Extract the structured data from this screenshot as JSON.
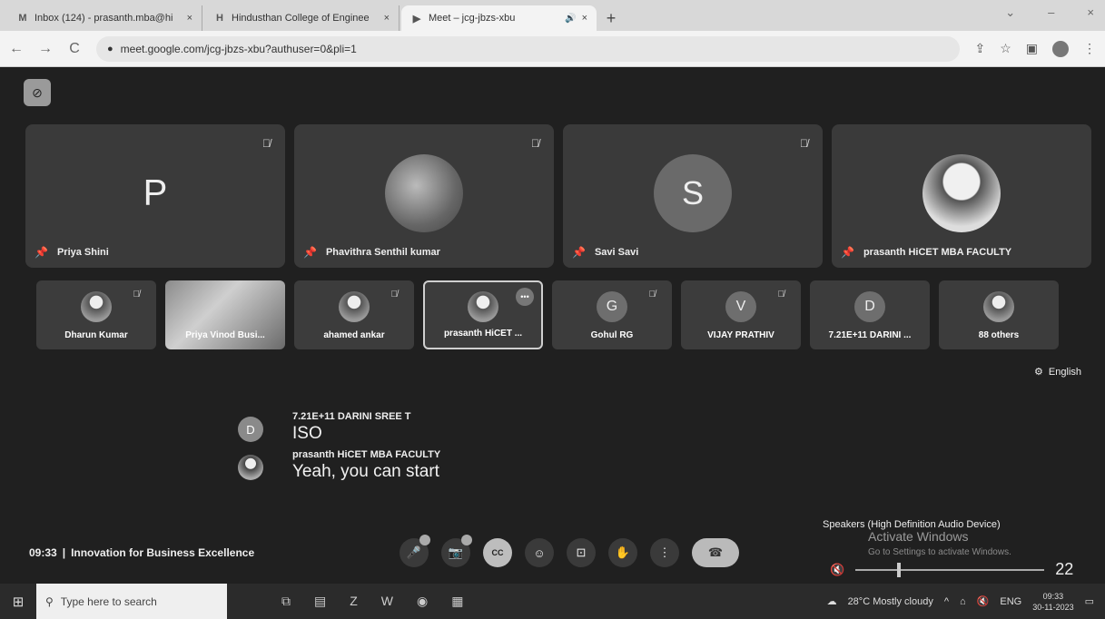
{
  "browser": {
    "tabs": [
      {
        "icon": "M",
        "title": "Inbox (124) - prasanth.mba@hi",
        "close": "×"
      },
      {
        "icon": "H",
        "title": "Hindusthan College of Enginee",
        "close": "×"
      },
      {
        "icon": "▶",
        "title": "Meet – jcg-jbzs-xbu",
        "close": "×",
        "audio": "🔊"
      }
    ],
    "new_tab": "+",
    "window_controls": [
      "⌄",
      "–",
      "×"
    ],
    "url": "meet.google.com/jcg-jbzs-xbu?authuser=0&pli=1"
  },
  "meet": {
    "captions_off_icon": "⊘",
    "big_tiles": [
      {
        "name": "Priya Shini",
        "avatar_type": "letter",
        "letter": "P"
      },
      {
        "name": "Phavithra Senthil kumar",
        "avatar_type": "photo"
      },
      {
        "name": "Savi Savi",
        "avatar_type": "circle",
        "letter": "S"
      },
      {
        "name": "prasanth HiCET MBA FACULTY",
        "avatar_type": "portrait"
      }
    ],
    "small_tiles": [
      {
        "name": "Dharun Kumar",
        "type": "photo-avatar",
        "muted": true
      },
      {
        "name": "Priya Vinod Busi...",
        "type": "video",
        "muted": false
      },
      {
        "name": "ahamed ankar",
        "type": "photo-avatar",
        "muted": true
      },
      {
        "name": "prasanth HiCET ...",
        "type": "photo-avatar",
        "muted": false,
        "selected": true,
        "more": "•••"
      },
      {
        "name": "Gohul RG",
        "type": "letter",
        "letter": "G",
        "muted": true
      },
      {
        "name": "VIJAY PRATHIV",
        "type": "letter",
        "letter": "V",
        "muted": true
      },
      {
        "name": "7.21E+11 DARINI ...",
        "type": "letter",
        "letter": "D",
        "muted": false
      },
      {
        "name": "88 others",
        "type": "photo-avatar",
        "muted": false
      }
    ],
    "language": "English",
    "captions": [
      {
        "avatar": "D",
        "name": "7.21E+11 DARINI SREE T",
        "text": "ISO"
      },
      {
        "avatar": "",
        "name": "prasanth HiCET MBA FACULTY",
        "text": "Yeah, you can start"
      }
    ],
    "time": "09:33",
    "separator": "|",
    "meeting_name": "Innovation for Business Excellence",
    "controls": [
      "🎤",
      "📷",
      "CC",
      "☺",
      "⊡",
      "✋",
      "⋮",
      "☎"
    ],
    "speakers_label": "Speakers (High Definition Audio Device)",
    "activate_title": "Activate Windows",
    "activate_sub": "Go to Settings to activate Windows.",
    "volume": "22",
    "volume_level": 0.22
  },
  "taskbar": {
    "start": "⊞",
    "search_placeholder": "Type here to search",
    "weather": "28°C  Mostly cloudy",
    "lang": "ENG",
    "clock_time": "09:33",
    "clock_date": "30-11-2023"
  }
}
